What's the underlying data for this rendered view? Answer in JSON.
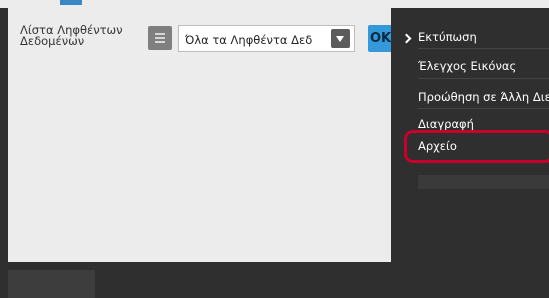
{
  "panel": {
    "title": "Λίστα Ληφθέντων Δεδομένων",
    "list_icon": "list-icon",
    "filter": {
      "selected": "Όλα τα Ληφθέντα Δεδ",
      "dropdown_icon": "chevron-down-icon"
    },
    "ok_label": "OK"
  },
  "menu": {
    "items": [
      {
        "label": "Εκτύπωση",
        "icon": "chevron-right-icon"
      },
      {
        "label": "Έλεγχος Εικόνας"
      },
      {
        "label": "Προώθηση σε Άλλη Διεύθ"
      },
      {
        "label": "Διαγραφή"
      },
      {
        "label": "Αρχείο",
        "highlighted": true
      }
    ]
  },
  "colors": {
    "accent": "#3498db",
    "highlight": "#c9002b",
    "menu_bg": "#2f2f2f",
    "panel_bg": "#ececec"
  }
}
